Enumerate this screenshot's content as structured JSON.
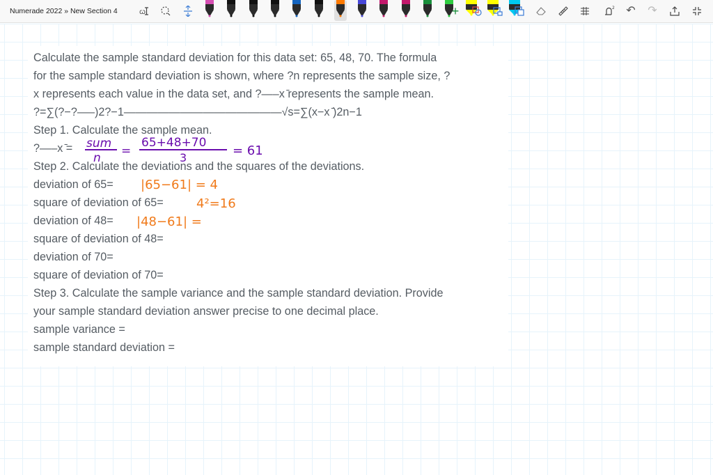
{
  "toolbar": {
    "breadcrumb": "Numerade 2022 » New Section 4",
    "icons": [
      "lasso-text-icon",
      "lasso-select-icon",
      "add-space-icon",
      "pens",
      "plus-icon",
      "ink-to-shape-icon",
      "ink-to-text-icon",
      "eraser-icon",
      "ruler-icon",
      "math-icon",
      "replay-icon",
      "undo-icon",
      "redo-icon",
      "share-icon",
      "fullscreen-icon"
    ],
    "pen_colors": [
      "#d64fb3",
      "#111111",
      "#111111",
      "#111111",
      "#1565c0",
      "#111111",
      "#ff7a00",
      "#4848d8",
      "#c3196c",
      "#c3196c",
      "#1a8f3c",
      "#2ecc40",
      "#ffff00",
      "#ffff00",
      "#00c8f0"
    ],
    "selected_pen_index": 6
  },
  "question": {
    "lines": [
      "Calculate the sample standard deviation for this data set: 65, 48, 70. The formula",
      "for the sample standard deviation is shown, where ?n represents the sample size, ?",
      "x represents each value in the data set, and ?—–x ̄represents the sample mean.",
      "?=∑(?−?—–)2?−1——————————————√s=∑(x−x ̄)2n−1",
      "Step 1. Calculate the sample mean.",
      "?—–x ̄=",
      "Step 2. Calculate the deviations and the squares of the deviations.",
      "deviation of 65=",
      "square of deviation of 65=",
      "deviation of 48=",
      "square of deviation of 48=",
      "deviation of 70=",
      "square of deviation of 70=",
      "Step 3. Calculate the sample variance and the sample standard deviation. Provide",
      "your sample standard deviation answer precise to one decimal place.",
      "sample variance =",
      "sample standard deviation ="
    ]
  },
  "handwriting": {
    "mean_sum": "sum",
    "mean_n": "n",
    "mean_eq1": "=",
    "mean_numerator": "65+48+70",
    "mean_denominator": "3",
    "mean_result": "= 61",
    "dev65": "|65−61| = 4",
    "sq65": "4²=16",
    "dev48": "|48−61| =",
    "ink_purple": "#6a0dad",
    "ink_orange": "#f07a1a"
  }
}
